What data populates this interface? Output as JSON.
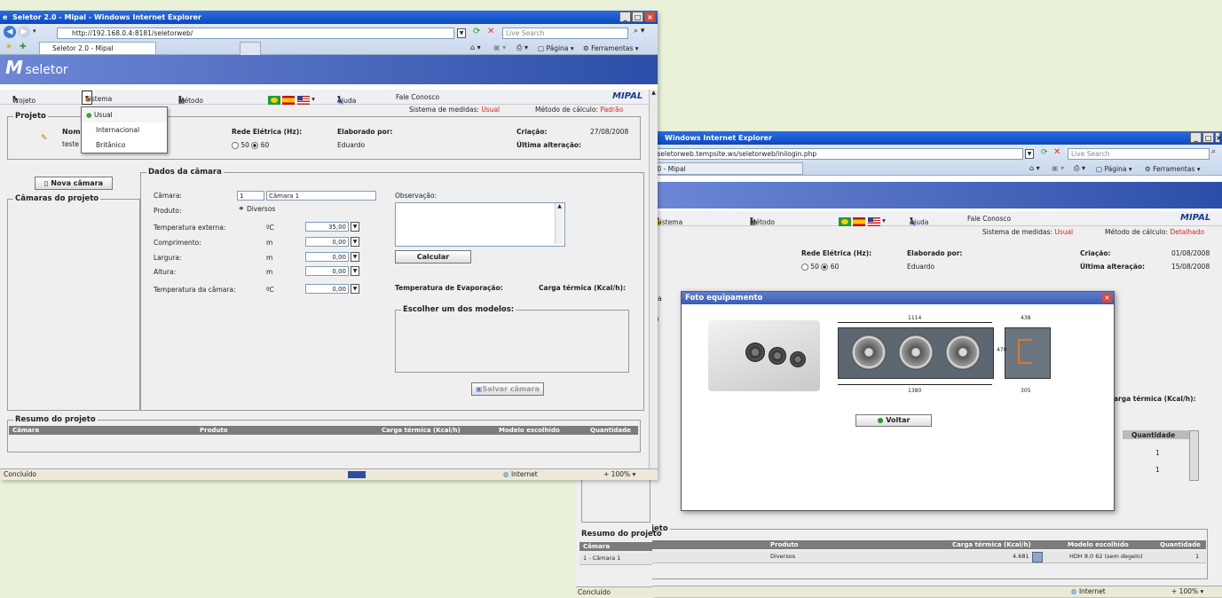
{
  "win1": {
    "title": "Seletor 2.0 - Mipal - Windows Internet Explorer",
    "url": "http://192.168.0.4:8181/seletorweb/",
    "search_placeholder": "Live Search",
    "tab": "Seletor 2.0 - Mipal",
    "toolbar": {
      "pagina": "Página",
      "ferramentas": "Ferramentas"
    },
    "logo": "seletor",
    "menu": {
      "projeto": "Projeto",
      "sistema": "Sistema de medidas",
      "metodo": "Método de cálculo",
      "ajuda": "Ajuda",
      "fale": "Fale Conosco",
      "brand": "MIPAL"
    },
    "dropdown": [
      "Usual",
      "Internacional",
      "Britânico"
    ],
    "info": {
      "sistema_label": "Sistema de medidas:",
      "sistema_value": "Usual",
      "metodo_label": "Método de cálculo:",
      "metodo_value": "Padrão"
    },
    "projeto": {
      "legend": "Projeto",
      "nome_label": "Nome",
      "nome_value": "teste",
      "rede_label": "Rede Elétrica (Hz):",
      "opt50": "50",
      "opt60": "60",
      "elaborado_label": "Elaborado por:",
      "elaborado_value": "Eduardo",
      "criacao_label": "Criação:",
      "criacao_value": "27/08/2008",
      "alteracao_label": "Última alteração:",
      "alteracao_value": ""
    },
    "nova_camara": "Nova câmara",
    "camaras_legend": "Câmaras do projeto",
    "dados": {
      "legend": "Dados da câmara",
      "camara_label": "Câmara:",
      "camara_num": "1",
      "camara_name": "Câmara 1",
      "produto_label": "Produto:",
      "produto_value": "Diversos",
      "temp_ext_label": "Temperatura externa:",
      "temp_ext_unit": "ºC",
      "temp_ext_value": "35,00",
      "comp_label": "Comprimento:",
      "comp_unit": "m",
      "comp_value": "0,00",
      "larg_label": "Largura:",
      "larg_unit": "m",
      "larg_value": "0,00",
      "alt_label": "Altura:",
      "alt_unit": "m",
      "alt_value": "0,00",
      "temp_cam_label": "Temperatura da câmara:",
      "temp_cam_unit": "ºC",
      "temp_cam_value": "0,00",
      "obs_label": "Observação:",
      "calcular": "Calcular",
      "evap_label": "Temperatura de Evaporação:",
      "carga_label": "Carga térmica (Kcal/h):",
      "modelos_legend": "Escolher um dos modelos:",
      "salvar": "Salvar câmara"
    },
    "resumo": {
      "legend": "Resumo do projeto",
      "headers": [
        "Câmara",
        "Produto",
        "Carga térmica (Kcal/h)",
        "Modelo escolhido",
        "Quantidade"
      ]
    },
    "status": {
      "text": "Concluído",
      "zone": "Internet",
      "zoom": "100%"
    }
  },
  "win2": {
    "title": "Windows Internet Explorer",
    "url": "/seletorweb.tempsite.ws/seletorweb/inilogin.php",
    "search_placeholder": "Live Search",
    "tab": ".0 - Mipal",
    "toolbar": {
      "pagina": "Página",
      "ferramentas": "Ferramentas"
    },
    "menu": {
      "sistema": "Sistema de medidas",
      "metodo": "Método de cálculo",
      "ajuda": "Ajuda",
      "fale": "Fale Conosco",
      "brand": "MIPAL"
    },
    "info": {
      "sistema_label": "Sistema de medidas:",
      "sistema_value": "Usual",
      "metodo_label": "Método de cálculo:",
      "metodo_value": "Detalhado"
    },
    "projeto": {
      "rede_label": "Rede Elétrica (Hz):",
      "opt50": "50",
      "opt60": "60",
      "elaborado_label": "Elaborado por:",
      "elaborado_value": "Eduardo",
      "criacao_label": "Criação:",
      "criacao_value": "01/08/2008",
      "alteracao_label": "Última alteração:",
      "alteracao_value": "15/08/2008"
    },
    "side_text": {
      "ra": "ra",
      "o": "o"
    },
    "carga_label": "arga térmica (Kcal/h):",
    "qty_header": "Quantidade",
    "qty_values": [
      "1",
      "1"
    ],
    "dialog": {
      "title": "Foto equipamento",
      "dims": {
        "top": "1114",
        "side_top": "438",
        "height": "470",
        "bottom": "1380",
        "inner": "305"
      },
      "voltar": "Voltar"
    },
    "resumo": {
      "legend": "Resumo do projeto",
      "headers": [
        "Câmara",
        "Produto",
        "Carga térmica (Kcal/h)",
        "Modelo escolhido",
        "Quantidade"
      ],
      "row": {
        "camara": "1 - Câmara 1",
        "produto": "Diversos",
        "carga": "4.681",
        "modelo": "HDH 8.0 62 (sem degelo)",
        "qtd": "1"
      }
    },
    "status": {
      "text": "Concluído",
      "zone": "Internet",
      "zoom": "100%"
    }
  }
}
